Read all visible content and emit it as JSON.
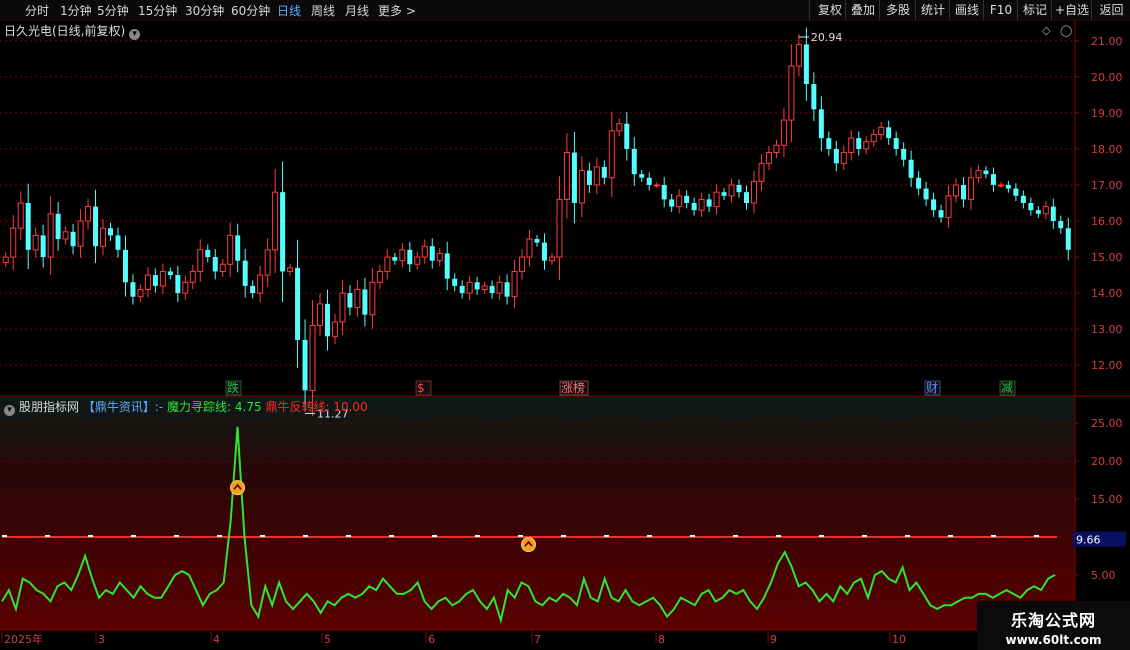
{
  "toolbar": {
    "left": [
      "分时",
      "1分钟",
      "5分钟",
      "15分钟",
      "30分钟",
      "60分钟",
      "日线",
      "周线",
      "月线",
      "更多 >"
    ],
    "active": "日线",
    "right": [
      "复权",
      "叠加",
      "多股",
      "统计",
      "画线",
      "F10",
      "标记",
      "+自选",
      "返回"
    ]
  },
  "price_panel": {
    "title": "日久光电(日线,前复权)",
    "dropdown_icon": "chevron-down-icon",
    "high_label": "20.94",
    "low_label": "11.27",
    "event_tags": [
      {
        "text": "跌",
        "color": "#27c24c"
      },
      {
        "text": "$",
        "color": "#ff4040"
      },
      {
        "text": "涨榜",
        "color": "#ff7070"
      },
      {
        "text": "财",
        "color": "#5a8cff"
      },
      {
        "text": "减",
        "color": "#27c24c"
      }
    ]
  },
  "indicator_panel": {
    "title": "股朋指标网",
    "tag": "【鼎牛资讯】:-",
    "line1": "魔力寻踪线: 4.75",
    "line2": "鼎牛反转线: 10.00",
    "marker_value": "9.66"
  },
  "chart_data": [
    {
      "type": "candlestick",
      "title": "日久光电(日线,前复权)",
      "ylim": [
        11.2,
        21.3
      ],
      "yticks": [
        12.0,
        13.0,
        14.0,
        15.0,
        16.0,
        17.0,
        18.0,
        19.0,
        20.0,
        21.0
      ],
      "x_labels": [
        "2025年",
        "3",
        "4",
        "5",
        "6",
        "7",
        "8",
        "9",
        "10"
      ],
      "up_color": "#ff3b3b",
      "down_color": "#54ffff",
      "points": [
        15.0,
        15.8,
        16.5,
        15.2,
        15.6,
        15.0,
        16.2,
        15.5,
        15.7,
        15.3,
        16.0,
        16.4,
        15.3,
        15.8,
        15.6,
        15.2,
        14.3,
        13.9,
        14.1,
        14.5,
        14.2,
        14.6,
        14.5,
        14.0,
        14.3,
        14.6,
        15.2,
        15.0,
        14.6,
        14.8,
        15.6,
        14.9,
        14.2,
        14.0,
        14.5,
        15.2,
        16.8,
        14.6,
        14.7,
        12.7,
        11.3,
        13.1,
        13.7,
        12.8,
        13.2,
        14.0,
        13.6,
        14.1,
        13.4,
        14.3,
        14.6,
        15.0,
        14.9,
        15.2,
        14.8,
        15.0,
        15.3,
        14.9,
        15.1,
        14.4,
        14.2,
        14.0,
        14.3,
        14.1,
        14.2,
        14.0,
        14.3,
        13.9,
        14.6,
        15.0,
        15.5,
        15.4,
        14.9,
        15.0,
        16.6,
        17.9,
        16.5,
        17.4,
        17.0,
        17.5,
        17.2,
        18.5,
        18.7,
        18.0,
        17.3,
        17.2,
        17.0,
        17.0,
        16.6,
        16.4,
        16.7,
        16.5,
        16.3,
        16.6,
        16.4,
        16.8,
        16.7,
        17.0,
        16.8,
        16.5,
        17.1,
        17.6,
        17.9,
        18.1,
        18.8,
        20.3,
        20.9,
        19.8,
        19.1,
        18.3,
        18.0,
        17.6,
        17.9,
        18.3,
        18.0,
        18.2,
        18.4,
        18.6,
        18.3,
        18.0,
        17.7,
        17.2,
        16.9,
        16.6,
        16.3,
        16.1,
        16.7,
        17.0,
        16.6,
        17.2,
        17.4,
        17.3,
        17.0,
        17.0,
        16.9,
        16.7,
        16.5,
        16.3,
        16.2,
        16.4,
        16.0,
        15.8,
        15.2
      ],
      "annotations": [
        {
          "text": "20.94",
          "value": 20.94
        },
        {
          "text": "11.27",
          "value": 11.27
        }
      ]
    },
    {
      "type": "line",
      "ylim": [
        -2,
        27
      ],
      "yticks": [
        5.0,
        10.0,
        15.0,
        20.0,
        25.0
      ],
      "series": [
        {
          "name": "魔力寻踪线",
          "color": "#2ee62e",
          "values": [
            1.5,
            3.0,
            0.5,
            4.5,
            4.0,
            3.0,
            2.5,
            1.5,
            3.5,
            4.0,
            3.0,
            5.0,
            7.5,
            4.5,
            2.0,
            3.0,
            2.5,
            4.0,
            3.0,
            2.0,
            3.5,
            2.5,
            2.0,
            2.0,
            3.5,
            5.0,
            5.5,
            5.0,
            3.0,
            1.0,
            2.5,
            3.0,
            4.0,
            12.0,
            24.5,
            10.0,
            1.0,
            -0.5,
            3.5,
            1.0,
            4.0,
            1.5,
            0.5,
            1.5,
            2.5,
            1.5,
            0.0,
            1.5,
            1.0,
            2.0,
            2.5,
            2.0,
            2.5,
            3.5,
            3.0,
            4.5,
            3.5,
            2.5,
            2.5,
            3.0,
            4.0,
            1.5,
            0.5,
            1.5,
            2.0,
            1.0,
            1.5,
            2.5,
            3.0,
            1.5,
            0.5,
            2.0,
            -1.0,
            3.0,
            2.0,
            4.0,
            3.5,
            1.5,
            1.0,
            2.0,
            1.5,
            2.5,
            2.0,
            1.0,
            4.5,
            2.0,
            1.5,
            4.5,
            2.0,
            1.5,
            3.0,
            1.5,
            1.0,
            1.5,
            2.0,
            1.0,
            -0.5,
            0.5,
            2.0,
            1.5,
            1.0,
            2.5,
            3.0,
            1.5,
            2.0,
            3.0,
            2.5,
            3.0,
            1.5,
            0.5,
            2.0,
            4.0,
            6.5,
            8.0,
            6.0,
            3.5,
            4.0,
            3.0,
            1.5,
            2.5,
            1.5,
            3.5,
            2.5,
            4.0,
            4.5,
            2.0,
            5.0,
            5.5,
            4.5,
            4.0,
            6.0,
            3.0,
            4.0,
            2.5,
            1.0,
            0.5,
            1.0,
            1.0,
            1.5,
            2.0,
            2.0,
            2.5,
            2.5,
            2.0,
            2.5,
            3.0,
            2.5,
            2.0,
            3.0,
            3.5,
            3.0,
            4.5,
            5.0
          ]
        },
        {
          "name": "鼎牛反转线",
          "color": "#ff2a2a",
          "values": [
            10.0,
            10.0
          ]
        }
      ],
      "signal_markers": [
        {
          "index": 34,
          "value": 16.5
        },
        {
          "index": 76,
          "value": 9.0
        }
      ]
    }
  ]
}
